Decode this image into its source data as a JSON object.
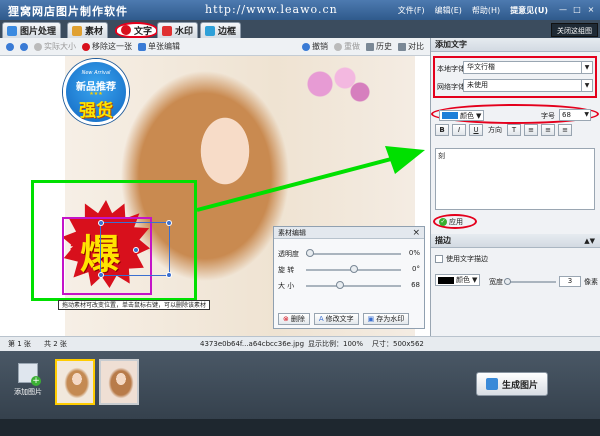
{
  "app": {
    "title": "狸窝网店图片制作软件",
    "url": "http://www.leawo.cn"
  },
  "menu": {
    "file": "文件(F)",
    "edit": "编辑(E)",
    "help": "帮助(H)",
    "feedback": "提意见(U)",
    "minimize": "—",
    "maximize": "□",
    "close": "×"
  },
  "tabs": [
    {
      "label": "图片处理",
      "icon": "image-process-icon"
    },
    {
      "label": "素材",
      "icon": "material-icon"
    },
    {
      "label": "文字",
      "icon": "text-icon"
    },
    {
      "label": "水印",
      "icon": "watermark-icon"
    },
    {
      "label": "边框",
      "icon": "border-icon"
    }
  ],
  "close_tab_label": "关闭这组图",
  "toolbar": {
    "actual_size": "实际大小",
    "remove_one": "移除这一张",
    "single_edit": "单张编辑",
    "undo": "撤销",
    "redo": "重做",
    "history": "历史",
    "compare": "对比"
  },
  "badge": {
    "en": "New Arrival",
    "line1": "新品推荐",
    "stars": "★★★",
    "line2": "强货"
  },
  "canvas_text": {
    "main": "爆",
    "small": "刻"
  },
  "tooltip": "拖动素材可改变位置，单击鼠标右键，可以删除该素材",
  "material_panel": {
    "title": "素材编辑",
    "close": "×",
    "rows": [
      {
        "label": "透明度",
        "value": "0%",
        "position": 0.0
      },
      {
        "label": "旋 转",
        "value": "0°",
        "position": 0.5
      },
      {
        "label": "大 小",
        "value": "68",
        "position": 0.35
      }
    ],
    "buttons": {
      "delete": "删除",
      "edit_text": "修改文字",
      "save_watermark": "存为水印"
    }
  },
  "right_panel": {
    "add_text_header": "添加文字",
    "local_font_label": "本地字体",
    "local_font_value": "华文行楷",
    "web_font_label": "网络字体",
    "web_font_value": "未使用",
    "color_label": "颜色",
    "color_value": "#1e7fd8",
    "size_label": "字号",
    "size_value": "68",
    "format_buttons": [
      "B",
      "I",
      "U"
    ],
    "direction_label": "方向",
    "align_buttons": [
      "T",
      "≡",
      "≡",
      "≡"
    ],
    "text_content": "刻",
    "apply_label": "应用",
    "stroke_header": "描边",
    "use_stroke_label": "使用文字描边",
    "stroke_color_label": "颜色",
    "stroke_color_value": "#000000",
    "stroke_width_label": "宽度",
    "stroke_width_value": "3",
    "stroke_unit": "像素"
  },
  "status": {
    "page": "第 1 张",
    "total": "共 2 张",
    "filename": "4373e0b64f...a64cbcc36e.jpg",
    "scale": "显示比例：100%",
    "dimensions": "尺寸：500x562"
  },
  "bottom": {
    "add_image": "添加图片",
    "generate": "生成图片"
  }
}
